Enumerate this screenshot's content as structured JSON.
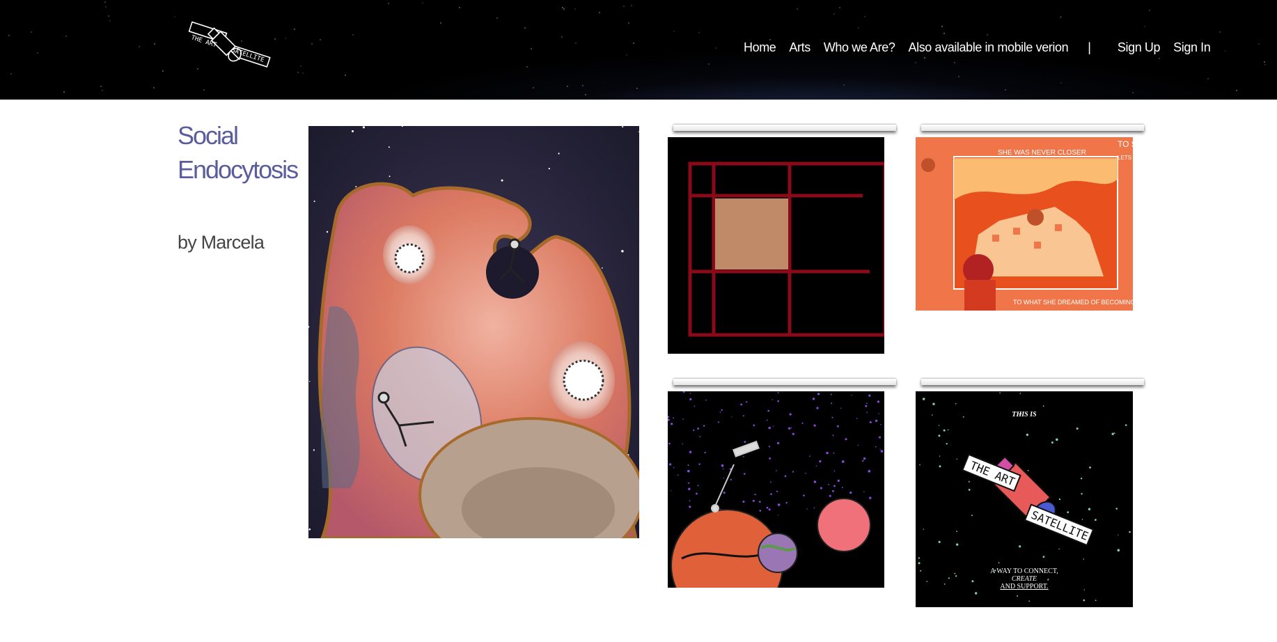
{
  "header": {
    "logo": {
      "name": "The Art Satellite logo",
      "text_line1": "THE ART",
      "text_line2": "SATELLITE"
    },
    "nav": {
      "home": "Home",
      "arts": "Arts",
      "who": "Who we Are?",
      "mobile": "Also available in mobile verion",
      "separator": "|",
      "signup": "Sign Up",
      "signin": "Sign In"
    }
  },
  "artwork": {
    "title": "Social Endocytosis",
    "byline": "by Marcela"
  },
  "thumbnails": [
    {
      "name": "red-grid-artwork"
    },
    {
      "name": "orange-window-artwork",
      "top_text": "SHE WAS NEVER CLOSER",
      "corner_text": "TO SPACE",
      "corner_sub": "LETS EXPLO",
      "bottom_text": "TO WHAT SHE DREAMED OF BECOMING"
    },
    {
      "name": "planets-astronaut-artwork"
    },
    {
      "name": "art-satellite-poster",
      "top_text": "THIS IS",
      "label1": "THE ART",
      "label2": "SATELLITE",
      "line1": "A WAY TO CONNECT,",
      "line2": "CREATE",
      "line3": "AND SUPPORT."
    }
  ],
  "colors": {
    "title": "#5a5c9c",
    "byline": "#444444",
    "header_bg": "#000000",
    "grid_red": "#8b0a1a",
    "grid_tan": "#c08a68",
    "orange": "#f0764a"
  }
}
